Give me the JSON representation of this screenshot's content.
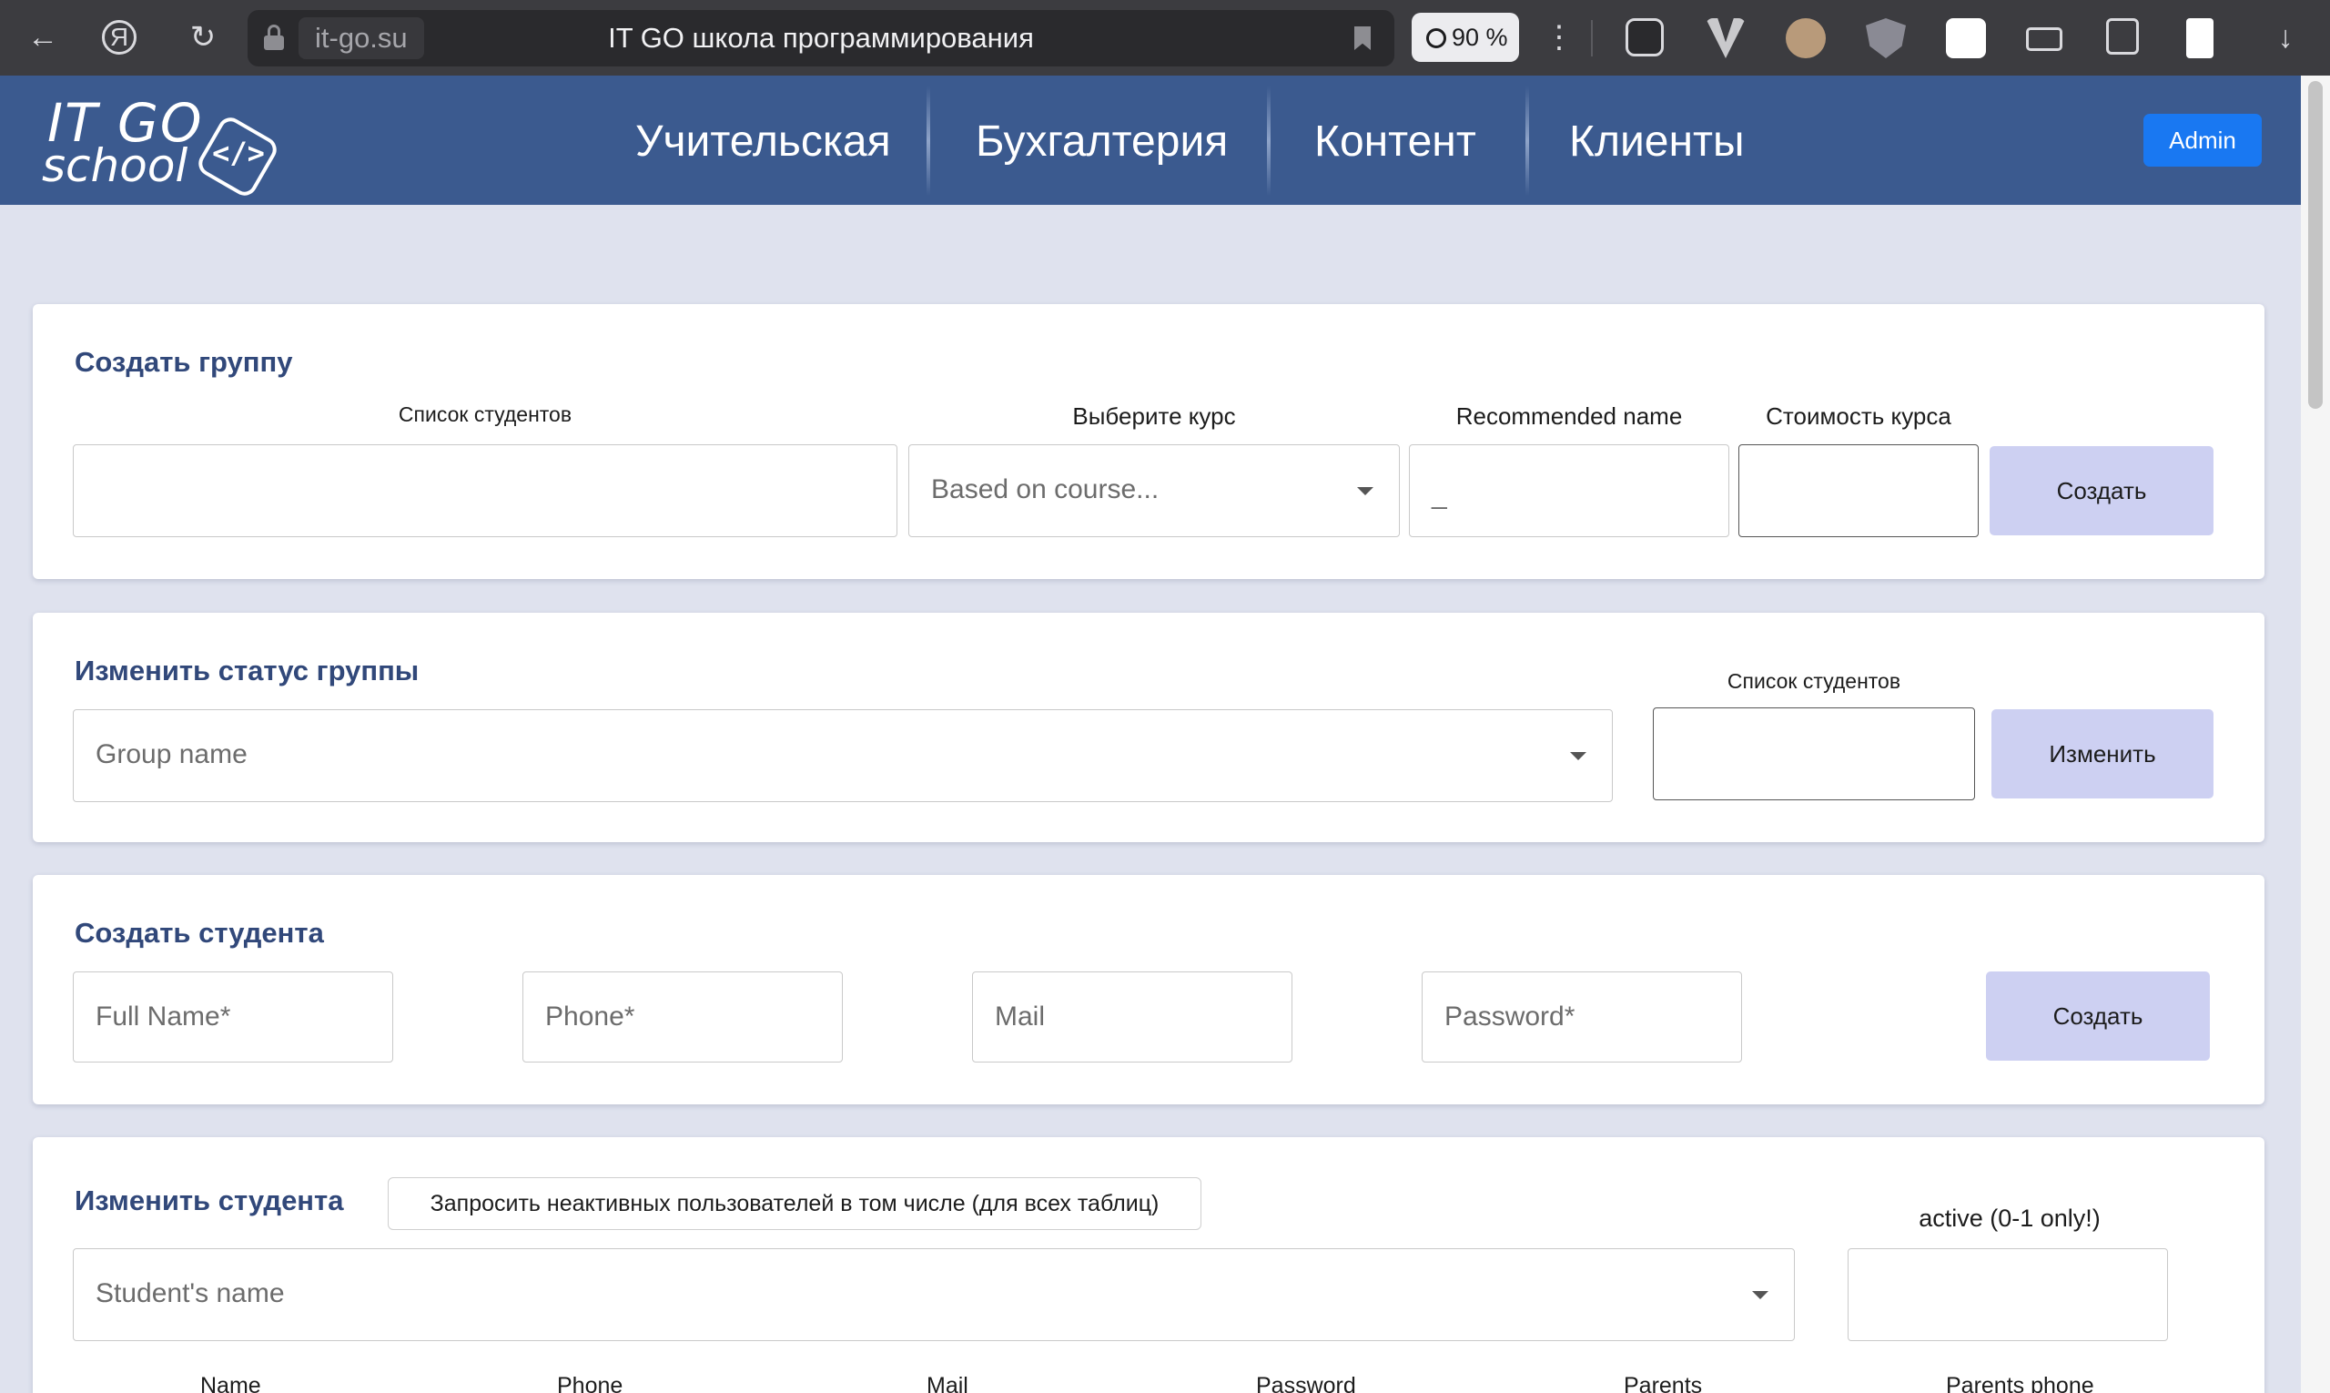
{
  "browser": {
    "domain": "it-go.su",
    "tab_title": "IT GO школа программирования",
    "zoom": "90 %"
  },
  "header": {
    "logo_line1": "IT GO",
    "logo_line2": "school",
    "logo_code": "</>",
    "nav": [
      "Учительская",
      "Бухгалтерия",
      "Контент",
      "Клиенты"
    ],
    "admin_label": "Admin"
  },
  "create_group": {
    "title": "Создать группу",
    "students_label": "Список студентов",
    "course_label": "Выберите курс",
    "course_placeholder": "Based on course...",
    "recommended_label": "Recommended name",
    "recommended_value": "_",
    "cost_label": "Стоимость курса",
    "submit_label": "Создать"
  },
  "change_group_status": {
    "title": "Изменить статус группы",
    "group_placeholder": "Group name",
    "students_label": "Список студентов",
    "submit_label": "Изменить"
  },
  "create_student": {
    "title": "Создать студента",
    "full_name_placeholder": "Full Name*",
    "phone_placeholder": "Phone*",
    "mail_placeholder": "Mail",
    "password_placeholder": "Password*",
    "submit_label": "Создать"
  },
  "edit_student": {
    "title": "Изменить студента",
    "inactive_toggle_label": "Запросить неактивных пользователей в том числе (для всех таблиц)",
    "active_label": "active (0-1 only!)",
    "student_placeholder": "Student's name",
    "columns": [
      "Name",
      "Phone",
      "Mail",
      "Password",
      "Parents",
      "Parents phone"
    ]
  }
}
